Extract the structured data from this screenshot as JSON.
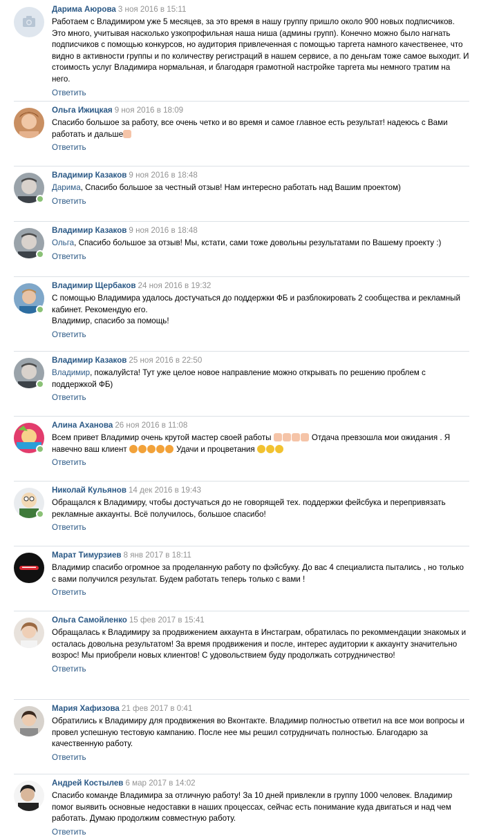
{
  "reply_label": "Ответить",
  "colors": {
    "author": "#2a5885",
    "date": "#939393",
    "separator": "#dce1e6",
    "online": "#8ac176"
  },
  "comments": [
    {
      "author": "Дарима Аюрова",
      "date": "3 ноя 2016 в 15:11",
      "avatar_icon": "camera-placeholder-icon",
      "online": false,
      "text": "Работаем с Владимиром уже 5 месяцев, за это время в нашу группу пришло около 900 новых подписчиков. Это много, учитывая насколько узкопрофильная наша ниша (админы групп). Конечно можно было нагнать подписчиков с помощью конкурсов, но аудитория привлеченная с помощью таргета намного качественее, что видно в активности группы и по количеству регистраций в нашем сервисе, а по деньгам тоже самое выходит. И стоимость услуг Владимира нормальная, и благодаря грамотной настройке таргета мы немного тратим на него."
    },
    {
      "author": "Ольга Ижицкая",
      "date": "9 ноя 2016 в 18:09",
      "avatar_icon": "user-photo-icon",
      "online": false,
      "text": "Спасибо большое за работу, все очень четко и во время и самое главное есть результат! надеюсь с Вами работать и дальше"
    },
    {
      "author": "Владимир Казаков",
      "date": "9 ноя 2016 в 18:48",
      "avatar_icon": "user-photo-icon",
      "online": true,
      "mention": "Дарима",
      "text": ", Спасибо большое за честный отзыв! Нам интересно работать над Вашим проектом)"
    },
    {
      "author": "Владимир Казаков",
      "date": "9 ноя 2016 в 18:48",
      "avatar_icon": "user-photo-icon",
      "online": true,
      "mention": "Ольга",
      "text": ", Спасибо большое за отзыв! Мы, кстати, сами тоже довольны результатами по Вашему проекту :)"
    },
    {
      "author": "Владимир Щербаков",
      "date": "24 ноя 2016 в 19:32",
      "avatar_icon": "user-photo-icon",
      "online": true,
      "text": "С помощью Владимира удалось достучаться до поддержки ФБ и разблокировать 2 сообщества и рекламный кабинет. Рекомендую его.",
      "text2": "Владимир, спасибо за помощь!"
    },
    {
      "author": "Владимир Казаков",
      "date": "25 ноя 2016 в 22:50",
      "avatar_icon": "user-photo-icon",
      "online": true,
      "mention": "Владимир",
      "text": ", пожалуйста! Тут уже целое новое направление можно открывать по решению проблем с поддержкой ФБ)"
    },
    {
      "author": "Алина Аханова",
      "date": "26 ноя 2016 в 11:08",
      "avatar_icon": "user-photo-icon",
      "online": true,
      "text": "Всем привет Владимир очень крутой мастер своей работы",
      "text_b": " Отдача превзошла мои ожидания . Я навечно ваш клиент",
      "text_c": " Удачи и процветания"
    },
    {
      "author": "Николай Кульянов",
      "date": "14 дек 2016 в 19:43",
      "avatar_icon": "user-photo-icon",
      "online": true,
      "text": "Обращался к Владимиру, чтобы достучаться до не говорящей тех. поддержки фейсбука и перепривязать рекламные аккаунты. Всё получилось, большое спасибо!"
    },
    {
      "author": "Марат Тимурзиев",
      "date": "8 янв 2017 в 18:11",
      "avatar_icon": "user-photo-icon",
      "online": false,
      "text": "Владимир спасибо огромное за проделанную работу по фэйсбуку. До вас 4 специалиста пытались , но только с вами получился результат. Будем работать теперь только с вами !"
    },
    {
      "author": "Ольга Самойленко",
      "date": "15 фев 2017 в 15:41",
      "avatar_icon": "user-photo-icon",
      "online": false,
      "text": "Обращалась к Владимиру за продвижением аккаунта в Инстаграм, обратилась по рекоммендации знакомых и осталась довольна результатом! За время продвижения и после, интерес аудитории к аккаунту значительно возрос! Мы приобрели новых клиентов! С удовольствием буду продолжать сотрудничество!"
    },
    {
      "author": "Мария Хафизова",
      "date": "21 фев 2017 в 0:41",
      "avatar_icon": "user-photo-icon",
      "online": false,
      "text": "Обратились к Владимиру для продвижения во Вконтакте. Владимир полностью ответил на все мои вопросы и провел успешную тестовую кампанию. После нее мы решил сотрудничать полностью. Благодарю за качественную работу."
    },
    {
      "author": "Андрей Костылев",
      "date": "6 мар 2017 в 14:02",
      "avatar_icon": "user-photo-icon",
      "online": false,
      "text": "Спасибо команде Владимира за отличную работу! За 10 дней привлекли в группу 1000 человек. Владимир помог выявить основные недоставки в наших процессах, сейчас есть понимание куда двигаться и над чем работать. Думаю продолжим совместную работу."
    }
  ]
}
